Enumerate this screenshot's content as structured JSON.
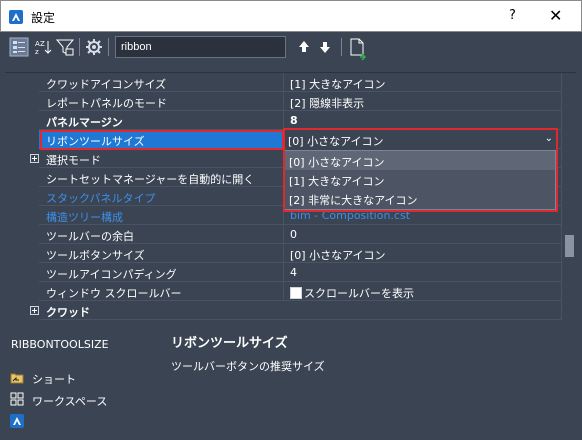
{
  "window": {
    "title": "設定",
    "help_label": "?",
    "close_label": "✕"
  },
  "toolbar": {
    "search_value": "ribbon"
  },
  "rows": [
    {
      "name": "クワッドアイコンサイズ",
      "value": "[1] 大きなアイコン"
    },
    {
      "name": "レポートパネルのモード",
      "value": "[2] 隠線非表示"
    },
    {
      "name": "パネルマージン",
      "value": "8"
    },
    {
      "name": "リボンツールサイズ",
      "value": ""
    },
    {
      "name": "選択モード",
      "value": ""
    },
    {
      "name": "シートセットマネージャーを自動的に開く",
      "value": ""
    },
    {
      "name": "スタックパネルタイプ",
      "value": ""
    },
    {
      "name": "構造ツリー構成",
      "value": "bim - Composition.cst"
    },
    {
      "name": "ツールバーの余白",
      "value": "0"
    },
    {
      "name": "ツールボタンサイズ",
      "value": "[0] 小さなアイコン"
    },
    {
      "name": "ツールアイコンパディング",
      "value": "4"
    },
    {
      "name": "ウィンドウ スクロールバー",
      "value": "スクロールバーを表示"
    },
    {
      "name": "クワッド",
      "value": ""
    }
  ],
  "combo": {
    "value": "[0] 小さなアイコン",
    "options": [
      "[0] 小さなアイコン",
      "[1] 大きなアイコン",
      "[2] 非常に大きなアイコン"
    ]
  },
  "bottom": {
    "variable": "RIBBONTOOLSIZE",
    "title": "リボンツールサイズ",
    "description": "ツールバーボタンの推奨サイズ",
    "links": [
      "ショート",
      "ワークスペース"
    ]
  },
  "colors": {
    "background": "#3b4453",
    "selection": "#1e78d4",
    "highlight_box": "#e0282f",
    "link_blue": "#3d8fe6"
  }
}
